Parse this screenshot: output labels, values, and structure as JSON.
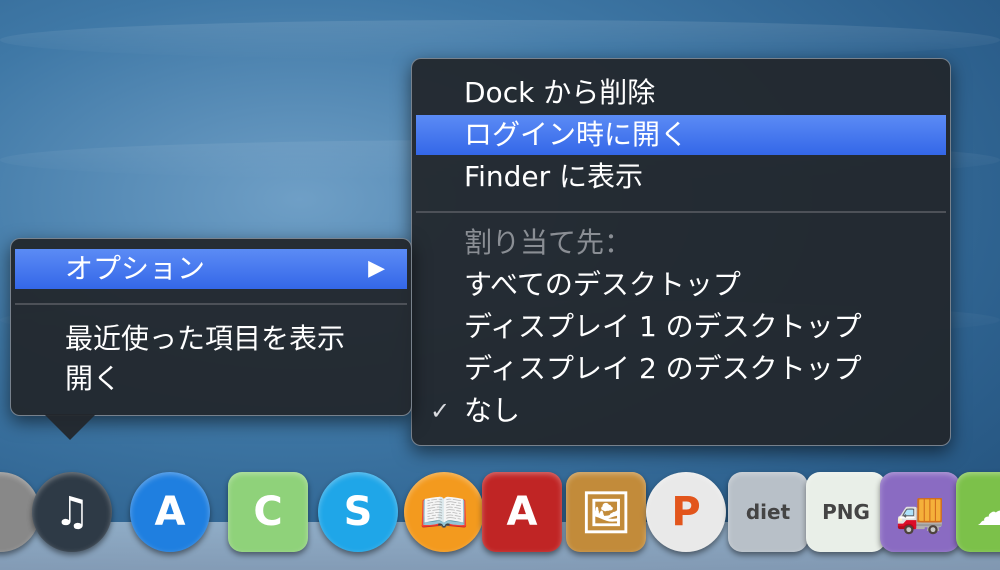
{
  "submenu": {
    "items": [
      {
        "label": "Dock から削除",
        "state": "normal"
      },
      {
        "label": "ログイン時に開く",
        "state": "selected"
      },
      {
        "label": "Finder に表示",
        "state": "normal"
      }
    ],
    "assign_header": "割り当て先：",
    "assign_options": [
      {
        "label": "すべてのデスクトップ",
        "checked": false
      },
      {
        "label": "ディスプレイ 1 のデスクトップ",
        "checked": false
      },
      {
        "label": "ディスプレイ 2 のデスクトップ",
        "checked": false
      },
      {
        "label": "なし",
        "checked": true
      }
    ],
    "check_glyph": "✓"
  },
  "mainmenu": {
    "options_label": "オプション",
    "arrow_glyph": "▶",
    "items": [
      {
        "label": "最近使った項目を表示"
      },
      {
        "label": "開く"
      }
    ]
  },
  "dock": {
    "icons": [
      {
        "name": "partial-app-icon",
        "glyph": "",
        "color": "#888888"
      },
      {
        "name": "itunes-icon",
        "glyph": "♫",
        "color": "#2e3a46"
      },
      {
        "name": "app-store-icon",
        "glyph": "A",
        "color": "#1f7fe0"
      },
      {
        "name": "coda-icon",
        "glyph": "C",
        "color": "#8fd27a"
      },
      {
        "name": "skype-icon",
        "glyph": "S",
        "color": "#1fa6e8"
      },
      {
        "name": "ibooks-icon",
        "glyph": "📖",
        "color": "#f39a1e"
      },
      {
        "name": "app-store-red-icon",
        "glyph": "A",
        "color": "#c02525"
      },
      {
        "name": "preview-icon",
        "glyph": "🖼",
        "color": "#c28b3a"
      },
      {
        "name": "presenter-icon",
        "glyph": "P",
        "color": "#e9e9e9"
      },
      {
        "name": "jpegmini-icon",
        "glyph": "diet",
        "color": "#b8c0c8"
      },
      {
        "name": "pngmini-icon",
        "glyph": "PNG",
        "color": "#e9efe8"
      },
      {
        "name": "transmit-icon",
        "glyph": "🚚",
        "color": "#8a6bc2"
      },
      {
        "name": "cloud-app-icon",
        "glyph": "☁",
        "color": "#7cc14a"
      }
    ]
  }
}
